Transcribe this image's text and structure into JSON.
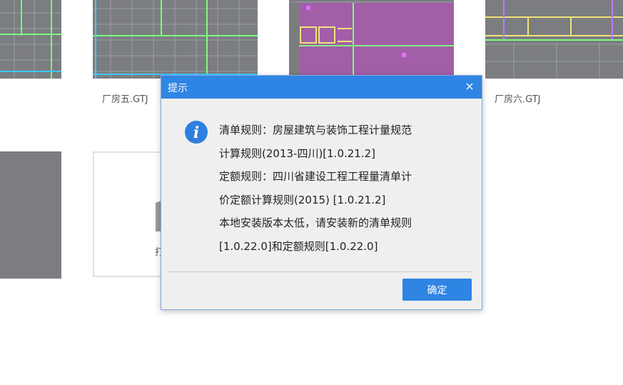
{
  "files": [
    {
      "name": ""
    },
    {
      "name": "厂房五.GTJ"
    },
    {
      "name": ""
    },
    {
      "name": "厂房六.GTJ"
    }
  ],
  "open_card": {
    "label": "打",
    "icon": "open-folder-icon"
  },
  "dialog": {
    "title": "提示",
    "close_label": "×",
    "icon": "info-icon",
    "message_lines": [
      "清单规则：房屋建筑与装饰工程计量规范",
      "计算规则(2013-四川)[1.0.21.2]",
      "定额规则：四川省建设工程工程量清单计",
      "价定额计算规则(2015) [1.0.21.2]",
      "本地安装版本太低，请安装新的清单规则",
      "[1.0.22.0]和定额规则[1.0.22.0]"
    ],
    "ok_label": "确定"
  },
  "colors": {
    "accent": "#2f85e3",
    "thumb_bg": "#7b7d80",
    "dialog_bg": "#efefef"
  }
}
